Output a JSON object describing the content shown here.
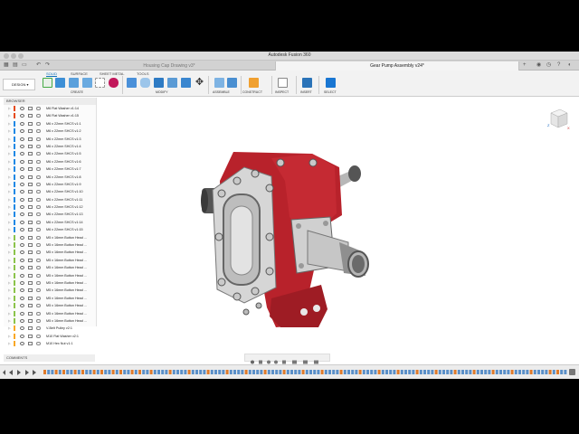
{
  "window": {
    "title": "Autodesk Fusion 360"
  },
  "tabs": [
    {
      "label": "Housing Cap Drawing v3*",
      "active": false
    },
    {
      "label": "Gear Pump Assembly v24*",
      "active": true
    }
  ],
  "ribbon": {
    "tabs": [
      "SOLID",
      "SURFACE",
      "SHEET METAL",
      "TOOLS"
    ],
    "active_tab": "SOLID",
    "workspace": "DESIGN",
    "groups": [
      "CREATE",
      "MODIFY",
      "ASSEMBLE",
      "CONSTRUCT",
      "INSPECT",
      "INSERT",
      "SELECT"
    ]
  },
  "browser": {
    "title": "BROWSER",
    "items": [
      {
        "label": "M6 Flat Washer v1:14",
        "color": "#e64a19"
      },
      {
        "label": "M6 Flat Washer v1:15",
        "color": "#e64a19"
      },
      {
        "label": "M6 x 22mm SHCS v1:1",
        "color": "#1e88e5"
      },
      {
        "label": "M6 x 22mm SHCS v1:2",
        "color": "#1e88e5"
      },
      {
        "label": "M6 x 22mm SHCS v1:3",
        "color": "#1e88e5"
      },
      {
        "label": "M6 x 22mm SHCS v1:4",
        "color": "#1e88e5"
      },
      {
        "label": "M6 x 22mm SHCS v1:5",
        "color": "#1e88e5"
      },
      {
        "label": "M6 x 22mm SHCS v1:6",
        "color": "#1e88e5"
      },
      {
        "label": "M6 x 22mm SHCS v1:7",
        "color": "#1e88e5"
      },
      {
        "label": "M6 x 22mm SHCS v1:8",
        "color": "#1e88e5"
      },
      {
        "label": "M6 x 22mm SHCS v1:9",
        "color": "#1e88e5"
      },
      {
        "label": "M6 x 22mm SHCS v1:10",
        "color": "#1e88e5"
      },
      {
        "label": "M6 x 22mm SHCS v1:11",
        "color": "#1e88e5"
      },
      {
        "label": "M6 x 22mm SHCS v1:12",
        "color": "#1e88e5"
      },
      {
        "label": "M6 x 22mm SHCS v1:13",
        "color": "#1e88e5"
      },
      {
        "label": "M6 x 22mm SHCS v1:14",
        "color": "#1e88e5"
      },
      {
        "label": "M6 x 22mm SHCS v1:15",
        "color": "#1e88e5"
      },
      {
        "label": "M5 x 16mm Button Head ...",
        "color": "#8bc34a"
      },
      {
        "label": "M5 x 16mm Button Head ...",
        "color": "#8bc34a"
      },
      {
        "label": "M5 x 16mm Button Head ...",
        "color": "#8bc34a"
      },
      {
        "label": "M5 x 16mm Button Head ...",
        "color": "#8bc34a"
      },
      {
        "label": "M5 x 16mm Button Head ...",
        "color": "#8bc34a"
      },
      {
        "label": "M5 x 16mm Button Head ...",
        "color": "#8bc34a"
      },
      {
        "label": "M5 x 16mm Button Head ...",
        "color": "#8bc34a"
      },
      {
        "label": "M5 x 16mm Button Head ...",
        "color": "#8bc34a"
      },
      {
        "label": "M5 x 16mm Button Head ...",
        "color": "#8bc34a"
      },
      {
        "label": "M5 x 16mm Button Head ...",
        "color": "#8bc34a"
      },
      {
        "label": "M5 x 16mm Button Head ...",
        "color": "#8bc34a"
      },
      {
        "label": "M5 x 16mm Button Head ...",
        "color": "#8bc34a"
      },
      {
        "label": "V-Belt Pulley v2:1",
        "color": "#f9a825"
      },
      {
        "label": "M10 Flat Washer v2:1",
        "color": "#f9a825"
      },
      {
        "label": "M10 Hex Nut v1:1",
        "color": "#f9a825"
      }
    ]
  },
  "comments": {
    "title": "COMMENTS"
  },
  "viewcube": {
    "labels": [
      "TOP",
      "FRONT",
      "RIGHT"
    ],
    "axis_x": "X",
    "axis_z": "Z"
  }
}
